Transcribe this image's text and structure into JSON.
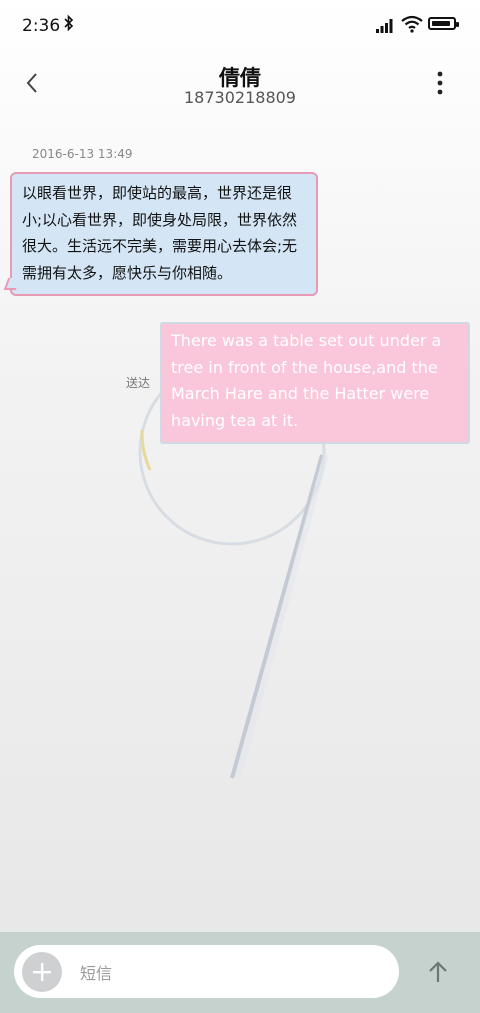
{
  "status_bar": {
    "time": "2:36",
    "icons": [
      "bluetooth-icon",
      "signal-icon",
      "wifi-icon",
      "battery-icon"
    ]
  },
  "header": {
    "contact_name": "倩倩",
    "contact_number": "18730218809",
    "icons": [
      "back-arrow-icon",
      "more-vertical-icon"
    ]
  },
  "conversation": {
    "timestamp": "2016-6-13 13:49",
    "received_message": "以眼看世界，即使站的最高，世界还是很小;以心看世界，即使身处局限，世界依然很大。生活远不完美，需要用心去体会;无需拥有太多，愿快乐与你相随。",
    "sent_message": "There was a table set out under a tree in front of the house,and the March Hare and the Hatter were having tea at it.",
    "sent_status": "送达"
  },
  "composer": {
    "placeholder": "短信",
    "icons": [
      "plus-icon",
      "send-arrow-icon"
    ]
  },
  "colors": {
    "received_bubble": "#d4e6f5",
    "received_border": "#e79ab6",
    "sent_bubble": "#f9c7d9",
    "composer_bar": "#c6d2cd"
  }
}
